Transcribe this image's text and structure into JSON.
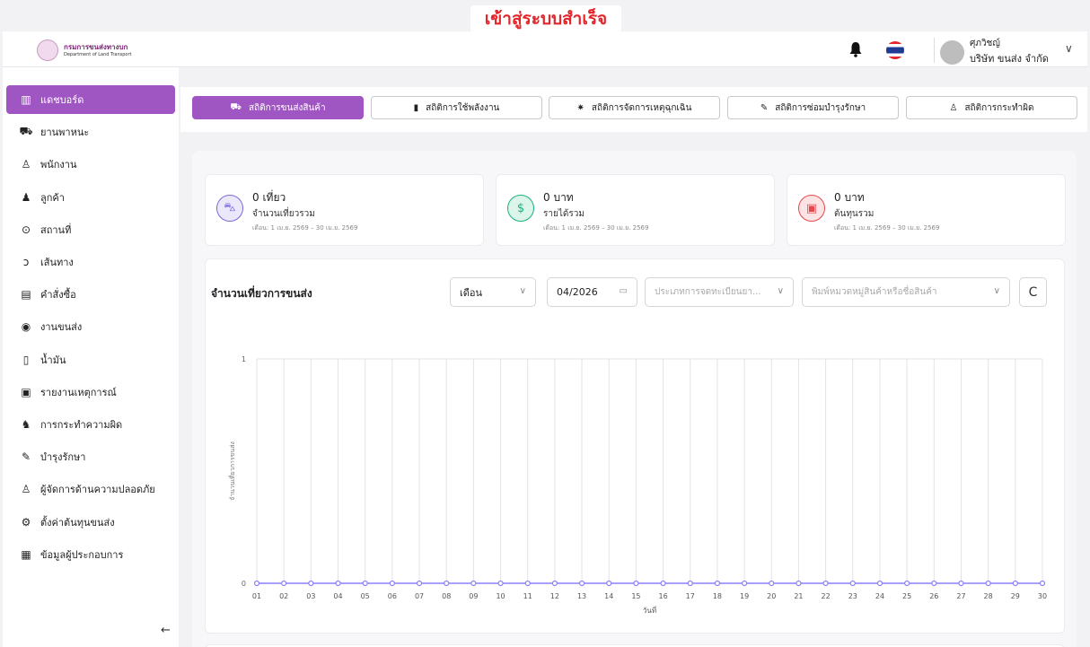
{
  "toast": "เข้าสู่ระบบสำเร็จ",
  "logo": {
    "name_th": "กรมการขนส่งทางบก",
    "name_en": "Department of Land Transport"
  },
  "user": {
    "name": "ศุภวิชญ์",
    "company": "บริษัท ขนส่ง จำกัด"
  },
  "sidebar": {
    "items": [
      {
        "label": "แดชบอร์ด",
        "icon": "bar-chart-icon",
        "active": true
      },
      {
        "label": "ยานพาหนะ",
        "icon": "truck-icon"
      },
      {
        "label": "พนักงาน",
        "icon": "user-icon"
      },
      {
        "label": "ลูกค้า",
        "icon": "users-icon"
      },
      {
        "label": "สถานที่",
        "icon": "location-pin-icon"
      },
      {
        "label": "เส้นทาง",
        "icon": "route-icon"
      },
      {
        "label": "คำสั่งซื้อ",
        "icon": "clipboard-icon"
      },
      {
        "label": "งานขนส่ง",
        "icon": "delivery-icon"
      },
      {
        "label": "น้ำมัน",
        "icon": "fuel-icon"
      },
      {
        "label": "รายงานเหตุการณ์",
        "icon": "report-icon"
      },
      {
        "label": "การกระทำความผิด",
        "icon": "offender-icon"
      },
      {
        "label": "บำรุงรักษา",
        "icon": "wrench-icon"
      },
      {
        "label": "ผู้จัดการด้านความปลอดภัย",
        "icon": "safety-manager-icon"
      },
      {
        "label": "ตั้งค่าต้นทุนขนส่ง",
        "icon": "gear-icon"
      },
      {
        "label": "ข้อมูลผู้ประกอบการ",
        "icon": "building-icon"
      }
    ]
  },
  "tabs": [
    {
      "label": "สถิติการขนส่งสินค้า",
      "icon": "truck-icon",
      "active": true
    },
    {
      "label": "สถิติการใช้พลังงาน",
      "icon": "battery-icon"
    },
    {
      "label": "สถิติการจัดการเหตุฉุกเฉิน",
      "icon": "siren-icon"
    },
    {
      "label": "สถิติการซ่อมบำรุงรักษา",
      "icon": "wrench-icon"
    },
    {
      "label": "สถิติการกระทำผิด",
      "icon": "user-icon"
    }
  ],
  "cards": [
    {
      "value": "0 เที่ยว",
      "label": "จำนวนเที่ยวรวม",
      "period": "เดือน: 1 เม.ย. 2569 – 30 เม.ย. 2569",
      "color": "#7b68d9",
      "bg": "#ece8fb"
    },
    {
      "value": "0 บาท",
      "label": "รายได้รวม",
      "period": "เดือน: 1 เม.ย. 2569 – 30 เม.ย. 2569",
      "color": "#1bb07a",
      "bg": "#dcf5ea"
    },
    {
      "value": "0 บาท",
      "label": "ต้นทุนรวม",
      "period": "เดือน: 1 เม.ย. 2569 – 30 เม.ย. 2569",
      "color": "#e5484d",
      "bg": "#fde4e4"
    }
  ],
  "chart_section": {
    "title": "จำนวนเที่ยวการขนส่ง",
    "period_select": "เดือน",
    "month_input": "04/2026",
    "registration_type_placeholder": "ประเภทการจดทะเบียนยา...",
    "product_search_placeholder": "พิมพ์หมวดหมู่สินค้าหรือชื่อสินค้า"
  },
  "chart_data": {
    "type": "line",
    "x": [
      "01",
      "02",
      "03",
      "04",
      "05",
      "06",
      "07",
      "08",
      "09",
      "10",
      "11",
      "12",
      "13",
      "14",
      "15",
      "16",
      "17",
      "18",
      "19",
      "20",
      "21",
      "22",
      "23",
      "24",
      "25",
      "26",
      "27",
      "28",
      "29",
      "30"
    ],
    "series": [
      {
        "name": "null",
        "values": [
          0,
          0,
          0,
          0,
          0,
          0,
          0,
          0,
          0,
          0,
          0,
          0,
          0,
          0,
          0,
          0,
          0,
          0,
          0,
          0,
          0,
          0,
          0,
          0,
          0,
          0,
          0,
          0,
          0,
          0
        ],
        "color": "#8b80f9"
      }
    ],
    "xlabel": "วันที่",
    "ylabel": "จำนวนเที่ยวการขนส่ง",
    "ylim": [
      0,
      1
    ],
    "yticks": [
      "0",
      "1"
    ],
    "grid": true,
    "legend": "bottom"
  }
}
